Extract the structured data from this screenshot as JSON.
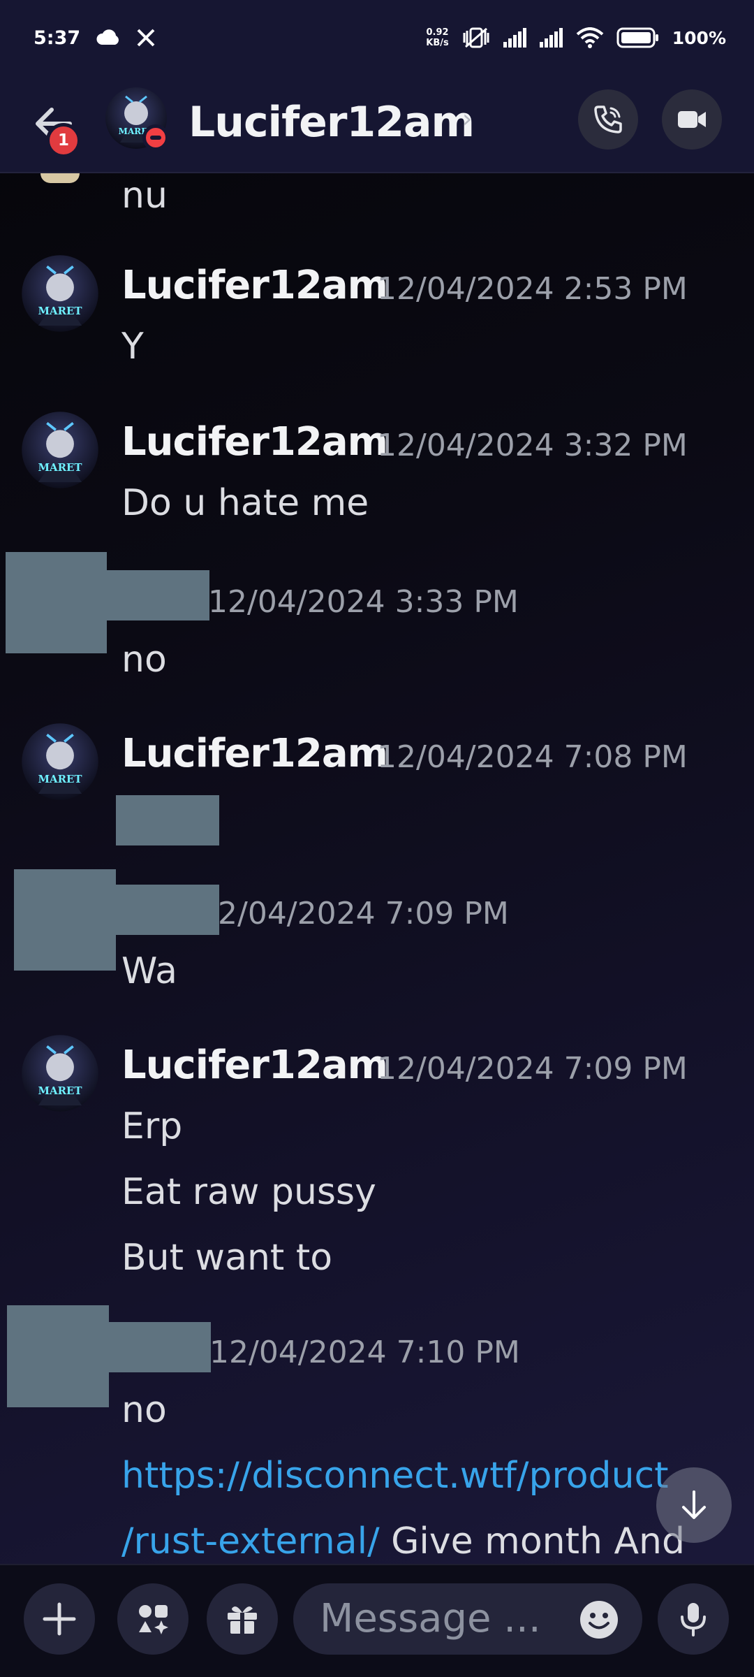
{
  "status_bar": {
    "time": "5:37",
    "netspeed_value": "0.92",
    "netspeed_unit": "KB/s",
    "battery": "100%"
  },
  "header": {
    "badge_count": "1",
    "name": "Lucifer12am",
    "chevron": "›",
    "icons": [
      "back-arrow-icon",
      "avatar",
      "dnd-status-icon",
      "phone-call-icon",
      "video-camera-icon"
    ]
  },
  "messages": [
    {
      "author": "",
      "lines": [
        "nu"
      ]
    },
    {
      "author": "Lucifer12am",
      "timestamp": "12/04/2024 2:53 PM",
      "lines": [
        "Y"
      ]
    },
    {
      "author": "Lucifer12am",
      "timestamp": "12/04/2024 3:32 PM",
      "lines": [
        "Do u hate me"
      ]
    },
    {
      "author": "",
      "timestamp": "12/04/2024 3:33 PM",
      "lines": [
        "no"
      ]
    },
    {
      "author": "Lucifer12am",
      "timestamp": "12/04/2024 7:08 PM",
      "lines": [
        ""
      ]
    },
    {
      "author": "",
      "timestamp": "2/04/2024 7:09 PM",
      "lines": [
        "Wa"
      ]
    },
    {
      "author": "Lucifer12am",
      "timestamp": "12/04/2024 7:09 PM",
      "lines": [
        "Erp",
        "Eat raw pussy",
        "But want to"
      ]
    },
    {
      "author": "",
      "timestamp": "12/04/2024 7:10 PM",
      "lines": [
        "no"
      ],
      "link_part1": "https://disconnect.wtf/product",
      "link_part2": "/rust-external/",
      "after_link": " Give month And"
    }
  ],
  "avatar_badge_text": "MARET",
  "input_bar": {
    "placeholder": "Message ...",
    "icons": [
      "plus-icon",
      "apps-icon",
      "gift-icon",
      "emoji-icon",
      "microphone-icon"
    ]
  },
  "colors": {
    "link": "#38a4ea",
    "redaction": "#5f7380",
    "badge": "#e13b3f",
    "background": "#0b0a14"
  }
}
